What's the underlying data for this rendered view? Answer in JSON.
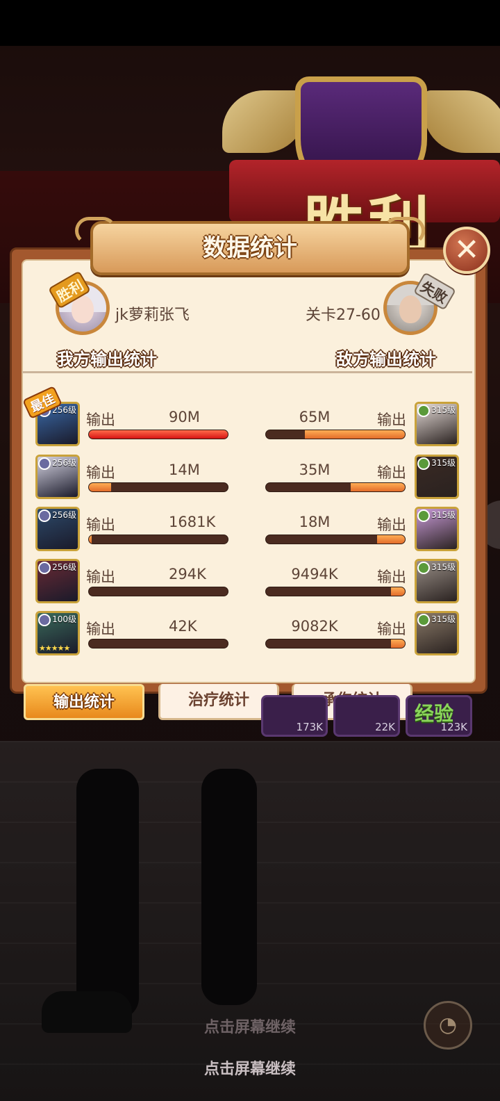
{
  "victory_title": "胜利",
  "panel": {
    "title": "数据统计"
  },
  "player": {
    "name": "jk萝莉张飞",
    "result_badge": "胜利",
    "section_label": "我方输出统计"
  },
  "enemy": {
    "name": "关卡27-60",
    "result_badge": "失败",
    "section_label": "敌方输出统计"
  },
  "best_tag": "最佳",
  "ally_rows": [
    {
      "level": "256级",
      "label": "输出",
      "value": "90M",
      "fill": 1.0,
      "best": true,
      "color": "#3a6aa8"
    },
    {
      "level": "256级",
      "label": "输出",
      "value": "14M",
      "fill": 0.16,
      "best": false,
      "color": "#d8d6e4"
    },
    {
      "level": "256级",
      "label": "输出",
      "value": "1681K",
      "fill": 0.02,
      "best": false,
      "color": "#2d4a6a"
    },
    {
      "level": "256级",
      "label": "输出",
      "value": "294K",
      "fill": 0.0,
      "best": false,
      "color": "#6a2a34"
    },
    {
      "level": "100级",
      "label": "输出",
      "value": "42K",
      "fill": 0.0,
      "best": false,
      "color": "#3a6a5a",
      "stars": "★★★★★"
    }
  ],
  "enemy_rows": [
    {
      "level": "315级",
      "label": "输出",
      "value": "65M",
      "fill": 0.72,
      "color": "#e6dcd8"
    },
    {
      "level": "315级",
      "label": "输出",
      "value": "35M",
      "fill": 0.39,
      "color": "#3a2a24"
    },
    {
      "level": "315级",
      "label": "输出",
      "value": "18M",
      "fill": 0.2,
      "color": "#c89ad8"
    },
    {
      "level": "315级",
      "label": "输出",
      "value": "9494K",
      "fill": 0.1,
      "color": "#9a9088"
    },
    {
      "level": "315级",
      "label": "输出",
      "value": "9082K",
      "fill": 0.1,
      "color": "#8a7a68"
    }
  ],
  "tabs": [
    {
      "label": "输出统计",
      "active": true
    },
    {
      "label": "治疗统计",
      "active": false
    },
    {
      "label": "承伤统计",
      "active": false
    }
  ],
  "rewards": [
    {
      "value": "173K"
    },
    {
      "value": "22K"
    },
    {
      "label": "经验",
      "value": "123K"
    }
  ],
  "continue_hint": "点击屏幕继续",
  "continue_hint_ghost": "点击屏幕继续"
}
